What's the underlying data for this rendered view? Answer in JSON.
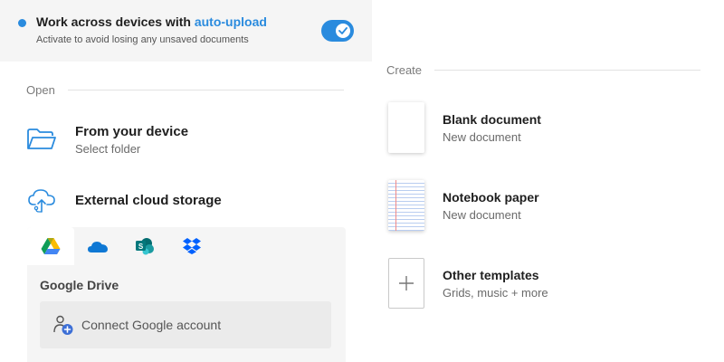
{
  "banner": {
    "title_prefix": "Work across devices with ",
    "title_accent": "auto-upload",
    "subtitle": "Activate to avoid losing any unsaved documents",
    "toggle_on": true
  },
  "open_section": {
    "heading": "Open",
    "device": {
      "title": "From your device",
      "subtitle": "Select folder",
      "icon": "folder-open-icon"
    },
    "cloud": {
      "title": "External cloud storage",
      "icon": "cloud-upload-icon",
      "tabs": [
        {
          "name": "google-drive",
          "icon": "google-drive-icon",
          "active": true
        },
        {
          "name": "onedrive",
          "icon": "onedrive-icon",
          "active": false
        },
        {
          "name": "sharepoint",
          "icon": "sharepoint-icon",
          "active": false
        },
        {
          "name": "dropbox",
          "icon": "dropbox-icon",
          "active": false
        }
      ],
      "provider_label": "Google Drive",
      "connect_label": "Connect Google account",
      "connect_icon": "add-account-icon"
    }
  },
  "create_section": {
    "heading": "Create",
    "items": [
      {
        "title": "Blank document",
        "subtitle": "New document",
        "thumb": "blank-page"
      },
      {
        "title": "Notebook paper",
        "subtitle": "New document",
        "thumb": "ruled-page"
      },
      {
        "title": "Other templates",
        "subtitle": "Grids, music + more",
        "thumb": "plus-icon"
      }
    ]
  },
  "colors": {
    "accent": "#2a8bde",
    "panel_bg": "#f5f5f5",
    "divider": "#e2e2e2"
  }
}
